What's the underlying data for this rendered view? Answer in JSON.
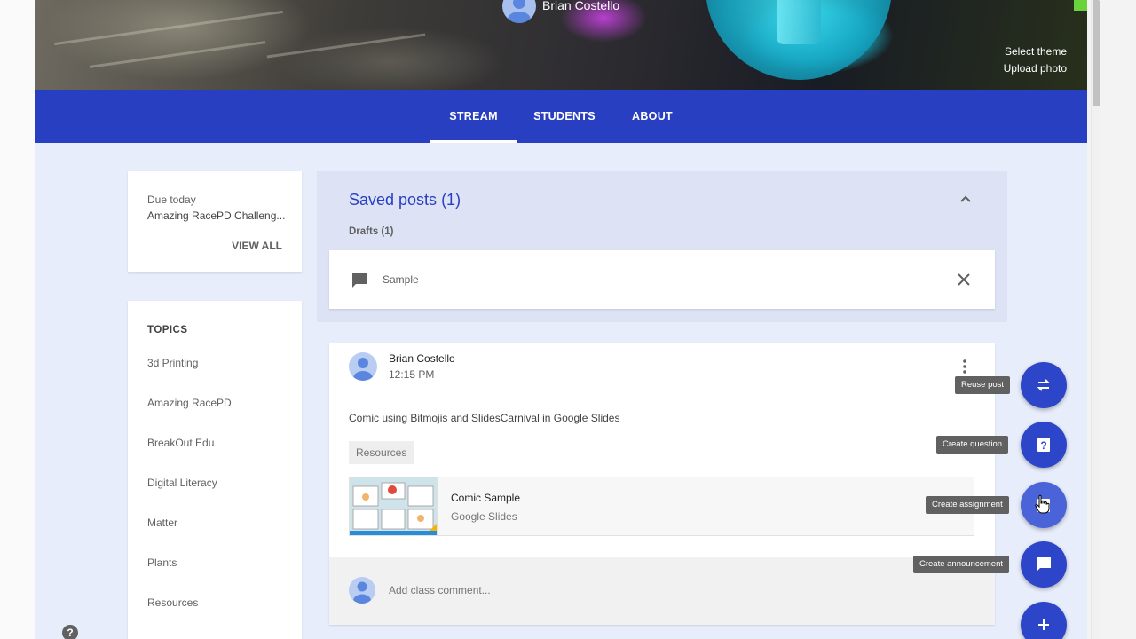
{
  "header": {
    "owner_name": "Brian Costello",
    "select_theme": "Select theme",
    "upload_photo": "Upload photo"
  },
  "tabs": [
    {
      "label": "STREAM",
      "active": true
    },
    {
      "label": "STUDENTS",
      "active": false
    },
    {
      "label": "ABOUT",
      "active": false
    }
  ],
  "due": {
    "label": "Due today",
    "item": "Amazing RacePD Challeng...",
    "view_all": "VIEW ALL"
  },
  "topics": {
    "title": "TOPICS",
    "items": [
      "3d Printing",
      "Amazing RacePD",
      "BreakOut Edu",
      "Digital Literacy",
      "Matter",
      "Plants",
      "Resources"
    ]
  },
  "saved_posts": {
    "title": "Saved posts (1)",
    "drafts_label": "Drafts (1)",
    "draft_text": "Sample"
  },
  "post": {
    "author": "Brian Costello",
    "time": "12:15 PM",
    "body": "Comic using Bitmojis and SlidesCarnival in Google Slides",
    "topic_chip": "Resources",
    "attachment_title": "Comic Sample",
    "attachment_type": "Google Slides",
    "comment_placeholder": "Add class comment..."
  },
  "fab_menu": {
    "reuse": "Reuse post",
    "question": "Create question",
    "assignment": "Create assignment",
    "announcement": "Create announcement"
  },
  "help_glyph": "?",
  "colors": {
    "primary": "#283fc1",
    "fab": "#2d45c9",
    "page_bg": "#e8edfb"
  }
}
